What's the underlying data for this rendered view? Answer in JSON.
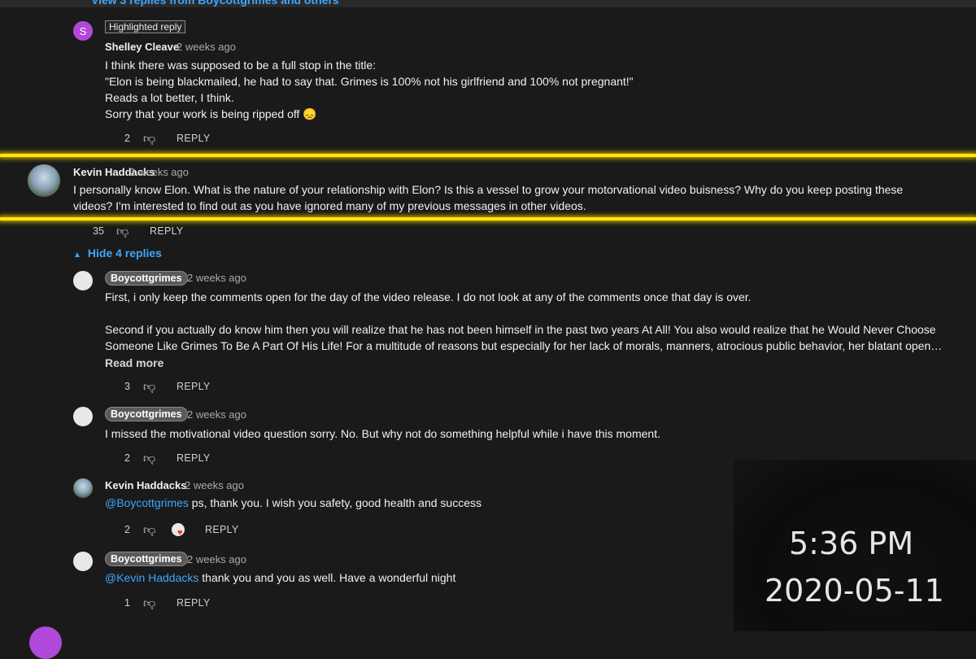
{
  "top": {
    "view_replies_link": "View 3 replies from Boycottgrimes and others"
  },
  "comments": [
    {
      "avatar_letter": "S",
      "highlight_badge": "Highlighted reply",
      "author": "Shelley Cleave",
      "time": "2 weeks ago",
      "lines": [
        "I think there was supposed to be a full stop in the title:",
        "\"Elon is being blackmailed, he had to say that. Grimes is 100% not his girlfriend and 100% not pregnant!\"",
        "Reads a lot better, I think.",
        "Sorry that your work is being ripped off 😞"
      ],
      "likes": "2",
      "reply_label": "REPLY"
    },
    {
      "author": "Kevin Haddacks",
      "time": "2 weeks ago",
      "lines": [
        "I personally know Elon. What is the nature of your relationship with Elon? Is this a vessel to grow your motorvational video buisness?   Why do you keep posting these",
        "videos? I'm interested to find out as you have ignored many of my previous messages in other videos."
      ],
      "likes": "35",
      "reply_label": "REPLY",
      "hide_replies": "Hide 4 replies"
    },
    {
      "author": "Boycottgrimes",
      "time": "2 weeks ago",
      "lines": [
        "First, i only keep the comments open for the day of the video release.  I do not look at any of the comments once that day is over.",
        "",
        "Second if you actually do know him then you will realize that he has not been himself in the past two years At All! You also would realize that he Would Never Choose",
        "Someone Like Grimes To Be A Part Of His Life! For a multitude of reasons but especially for her lack of morals, manners, atrocious public behavior, her blatant open…"
      ],
      "read_more": "Read more",
      "likes": "3",
      "reply_label": "REPLY"
    },
    {
      "author": "Boycottgrimes",
      "time": "2 weeks ago",
      "lines": [
        "I missed the motivational video question sorry.  No. But why not do something helpful while i have this moment."
      ],
      "likes": "2",
      "reply_label": "REPLY"
    },
    {
      "author": "Kevin Haddacks",
      "time": "2 weeks ago",
      "mention": "@Boycottgrimes",
      "text": " ps, thank you. I wish you safety, good health  and success",
      "likes": "2",
      "reply_label": "REPLY"
    },
    {
      "author": "Boycottgrimes",
      "time": "2 weeks ago",
      "mention": "@Kevin Haddacks",
      "text": " thank you and you as well. Have a wonderful night",
      "likes": "1",
      "reply_label": "REPLY"
    }
  ],
  "clock": {
    "time": "5:36 PM",
    "date": "2020-05-11"
  },
  "colors": {
    "highlight_line": "#ffe600",
    "link": "#3ea6ff",
    "background": "#1a1a1a"
  },
  "icons": {
    "dislike": "thumb-down-icon",
    "expand": "caret-up-icon",
    "creator_heart": "heart-icon"
  }
}
